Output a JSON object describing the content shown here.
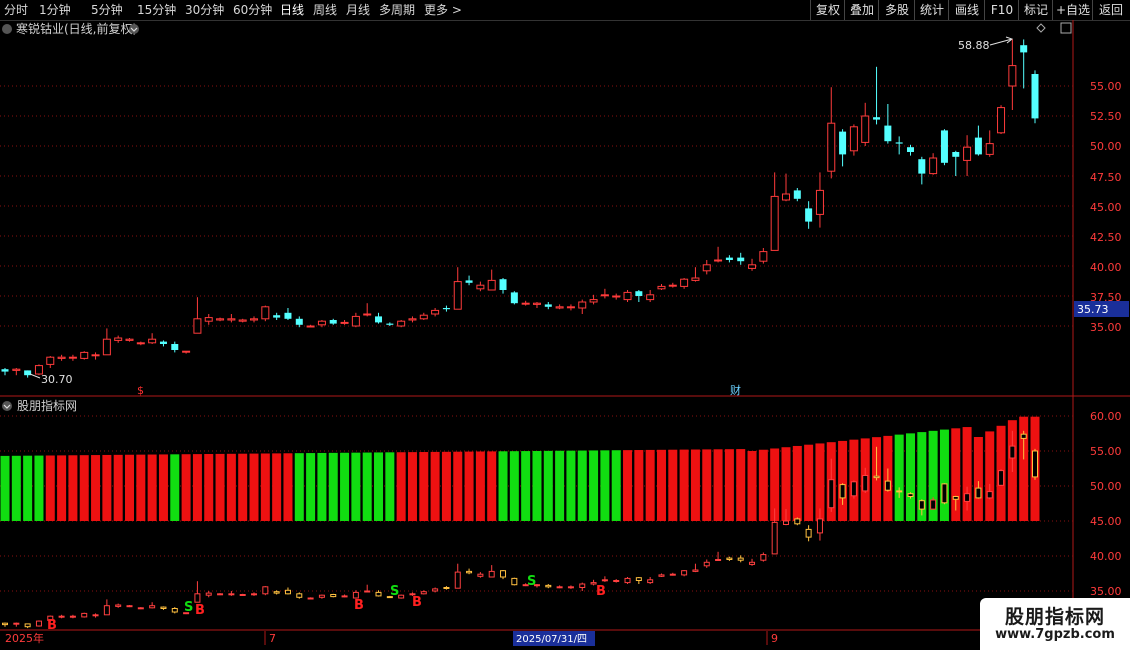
{
  "toolbar": {
    "periods": [
      "分时",
      "1分钟",
      "5分钟",
      "15分钟",
      "30分钟",
      "60分钟",
      "日线",
      "周线",
      "月线",
      "多周期",
      "更多 >"
    ],
    "active_period": "日线",
    "buttons": [
      "复权",
      "叠加",
      "多股",
      "统计",
      "画线",
      "F10",
      "标记",
      "+自选",
      "返回"
    ]
  },
  "main_panel": {
    "title": "寒锐钴业(日线,前复权)",
    "high_label": "58.88",
    "low_label": "30.70",
    "current_price": "35.73",
    "price_ticks": [
      "55.00",
      "52.50",
      "50.00",
      "47.50",
      "45.00",
      "42.50",
      "40.00",
      "37.50",
      "35.00"
    ],
    "markers": [
      "$",
      "财"
    ]
  },
  "indicator_panel": {
    "title": "股朋指标网",
    "ticks": [
      "60.00",
      "55.00",
      "50.00",
      "45.00",
      "40.00",
      "35.00"
    ],
    "signals": [
      "B",
      "S",
      "B",
      "B",
      "S",
      "B",
      "S",
      "B"
    ]
  },
  "time_axis": {
    "labels": [
      "2025年",
      "7",
      "2025/07/31/四",
      "9"
    ]
  },
  "watermark": {
    "title": "股朋指标网",
    "url": "www.7gpzb.com"
  },
  "colors": {
    "up": "#ff3b3b",
    "down": "#54ffff",
    "green_bar": "#11dd11",
    "red_bar": "#ee1111",
    "grid": "#8a1010"
  },
  "chart_data": {
    "type": "candlestick",
    "ylim_main": [
      30,
      60
    ],
    "ylim_indicator": [
      33,
      62
    ],
    "candles": [
      {
        "o": 31.4,
        "c": 31.2,
        "h": 31.5,
        "l": 30.9
      },
      {
        "o": 31.3,
        "c": 31.4,
        "h": 31.5,
        "l": 30.9
      },
      {
        "o": 31.3,
        "c": 30.9,
        "h": 31.3,
        "l": 30.7
      },
      {
        "o": 31.0,
        "c": 31.7,
        "h": 31.8,
        "l": 30.9
      },
      {
        "o": 31.8,
        "c": 32.4,
        "h": 32.5,
        "l": 31.5
      },
      {
        "o": 32.3,
        "c": 32.4,
        "h": 32.6,
        "l": 32.1
      },
      {
        "o": 32.4,
        "c": 32.4,
        "h": 32.6,
        "l": 32.1
      },
      {
        "o": 32.3,
        "c": 32.8,
        "h": 32.9,
        "l": 32.2
      },
      {
        "o": 32.6,
        "c": 32.6,
        "h": 32.8,
        "l": 32.2
      },
      {
        "o": 32.6,
        "c": 33.9,
        "h": 34.8,
        "l": 32.6
      },
      {
        "o": 33.8,
        "c": 34.0,
        "h": 34.2,
        "l": 33.6
      },
      {
        "o": 33.8,
        "c": 33.9,
        "h": 34.0,
        "l": 33.7
      },
      {
        "o": 33.6,
        "c": 33.6,
        "h": 33.7,
        "l": 33.4
      },
      {
        "o": 33.6,
        "c": 33.9,
        "h": 34.4,
        "l": 33.5
      },
      {
        "o": 33.7,
        "c": 33.5,
        "h": 33.8,
        "l": 33.3
      },
      {
        "o": 33.5,
        "c": 33.0,
        "h": 33.7,
        "l": 32.8
      },
      {
        "o": 32.9,
        "c": 32.9,
        "h": 32.9,
        "l": 32.7
      },
      {
        "o": 34.4,
        "c": 35.6,
        "h": 37.4,
        "l": 34.4
      },
      {
        "o": 35.4,
        "c": 35.7,
        "h": 36.0,
        "l": 35.1
      },
      {
        "o": 35.5,
        "c": 35.6,
        "h": 35.7,
        "l": 35.4
      },
      {
        "o": 35.5,
        "c": 35.6,
        "h": 36.0,
        "l": 35.3
      },
      {
        "o": 35.4,
        "c": 35.5,
        "h": 35.6,
        "l": 35.3
      },
      {
        "o": 35.5,
        "c": 35.6,
        "h": 35.8,
        "l": 35.3
      },
      {
        "o": 35.6,
        "c": 36.6,
        "h": 36.7,
        "l": 35.4
      },
      {
        "o": 35.9,
        "c": 35.7,
        "h": 36.1,
        "l": 35.5
      },
      {
        "o": 36.1,
        "c": 35.6,
        "h": 36.5,
        "l": 35.5
      },
      {
        "o": 35.6,
        "c": 35.1,
        "h": 35.8,
        "l": 34.9
      },
      {
        "o": 35.0,
        "c": 35.0,
        "h": 35.1,
        "l": 34.9
      },
      {
        "o": 35.1,
        "c": 35.4,
        "h": 35.5,
        "l": 34.9
      },
      {
        "o": 35.5,
        "c": 35.2,
        "h": 35.6,
        "l": 35.1
      },
      {
        "o": 35.3,
        "c": 35.3,
        "h": 35.5,
        "l": 35.1
      },
      {
        "o": 35.0,
        "c": 35.8,
        "h": 36.1,
        "l": 34.9
      },
      {
        "o": 36.0,
        "c": 36.0,
        "h": 36.9,
        "l": 35.8
      },
      {
        "o": 35.8,
        "c": 35.3,
        "h": 36.1,
        "l": 35.2
      },
      {
        "o": 35.2,
        "c": 35.1,
        "h": 35.3,
        "l": 35.0
      },
      {
        "o": 35.0,
        "c": 35.4,
        "h": 35.5,
        "l": 34.9
      },
      {
        "o": 35.5,
        "c": 35.6,
        "h": 35.8,
        "l": 35.3
      },
      {
        "o": 35.6,
        "c": 35.9,
        "h": 36.1,
        "l": 35.5
      },
      {
        "o": 36.0,
        "c": 36.3,
        "h": 36.5,
        "l": 35.8
      },
      {
        "o": 36.5,
        "c": 36.4,
        "h": 36.7,
        "l": 36.2
      },
      {
        "o": 36.4,
        "c": 38.7,
        "h": 39.9,
        "l": 36.4
      },
      {
        "o": 38.8,
        "c": 38.6,
        "h": 39.2,
        "l": 38.4
      },
      {
        "o": 38.1,
        "c": 38.4,
        "h": 38.7,
        "l": 37.9
      },
      {
        "o": 38.0,
        "c": 38.8,
        "h": 39.7,
        "l": 38.0
      },
      {
        "o": 38.9,
        "c": 38.0,
        "h": 39.0,
        "l": 37.7
      },
      {
        "o": 37.8,
        "c": 36.9,
        "h": 37.9,
        "l": 36.8
      },
      {
        "o": 36.9,
        "c": 36.9,
        "h": 37.1,
        "l": 36.7
      },
      {
        "o": 36.8,
        "c": 36.9,
        "h": 37.0,
        "l": 36.5
      },
      {
        "o": 36.8,
        "c": 36.6,
        "h": 37.0,
        "l": 36.4
      },
      {
        "o": 36.5,
        "c": 36.6,
        "h": 36.8,
        "l": 36.4
      },
      {
        "o": 36.6,
        "c": 36.6,
        "h": 36.8,
        "l": 36.3
      },
      {
        "o": 36.5,
        "c": 37.0,
        "h": 37.2,
        "l": 36.0
      },
      {
        "o": 37.0,
        "c": 37.2,
        "h": 37.6,
        "l": 36.8
      },
      {
        "o": 37.6,
        "c": 37.6,
        "h": 38.1,
        "l": 37.3
      },
      {
        "o": 37.5,
        "c": 37.5,
        "h": 37.7,
        "l": 37.2
      },
      {
        "o": 37.2,
        "c": 37.8,
        "h": 38.0,
        "l": 37.0
      },
      {
        "o": 37.9,
        "c": 37.5,
        "h": 38.0,
        "l": 37.0
      },
      {
        "o": 37.2,
        "c": 37.6,
        "h": 38.0,
        "l": 37.0
      },
      {
        "o": 38.1,
        "c": 38.3,
        "h": 38.5,
        "l": 38.0
      },
      {
        "o": 38.4,
        "c": 38.4,
        "h": 38.6,
        "l": 38.2
      },
      {
        "o": 38.3,
        "c": 38.9,
        "h": 39.0,
        "l": 38.1
      },
      {
        "o": 38.8,
        "c": 39.0,
        "h": 39.9,
        "l": 38.7
      },
      {
        "o": 39.6,
        "c": 40.1,
        "h": 40.5,
        "l": 39.3
      },
      {
        "o": 40.5,
        "c": 40.5,
        "h": 41.6,
        "l": 40.3
      },
      {
        "o": 40.7,
        "c": 40.5,
        "h": 40.9,
        "l": 40.3
      },
      {
        "o": 40.7,
        "c": 40.4,
        "h": 41.1,
        "l": 40.1
      },
      {
        "o": 39.8,
        "c": 40.1,
        "h": 40.6,
        "l": 39.6
      },
      {
        "o": 40.4,
        "c": 41.2,
        "h": 41.5,
        "l": 40.2
      },
      {
        "o": 41.3,
        "c": 45.8,
        "h": 47.8,
        "l": 41.3
      },
      {
        "o": 45.5,
        "c": 46.0,
        "h": 47.7,
        "l": 45.4
      },
      {
        "o": 46.3,
        "c": 45.6,
        "h": 46.5,
        "l": 45.4
      },
      {
        "o": 44.8,
        "c": 43.7,
        "h": 45.4,
        "l": 43.1
      },
      {
        "o": 44.3,
        "c": 46.3,
        "h": 47.8,
        "l": 43.2
      },
      {
        "o": 47.9,
        "c": 51.9,
        "h": 54.9,
        "l": 47.3
      },
      {
        "o": 51.2,
        "c": 49.3,
        "h": 51.4,
        "l": 48.3
      },
      {
        "o": 49.6,
        "c": 51.6,
        "h": 51.8,
        "l": 49.2
      },
      {
        "o": 50.3,
        "c": 52.5,
        "h": 53.6,
        "l": 50.0
      },
      {
        "o": 52.4,
        "c": 52.2,
        "h": 56.6,
        "l": 51.8
      },
      {
        "o": 51.7,
        "c": 50.4,
        "h": 53.5,
        "l": 50.2
      },
      {
        "o": 50.3,
        "c": 50.2,
        "h": 50.8,
        "l": 49.3
      },
      {
        "o": 49.9,
        "c": 49.5,
        "h": 50.1,
        "l": 49.2
      },
      {
        "o": 48.9,
        "c": 47.7,
        "h": 49.1,
        "l": 46.8
      },
      {
        "o": 47.7,
        "c": 49.0,
        "h": 49.4,
        "l": 47.6
      },
      {
        "o": 51.3,
        "c": 48.6,
        "h": 51.4,
        "l": 48.4
      },
      {
        "o": 49.5,
        "c": 49.1,
        "h": 49.6,
        "l": 47.5
      },
      {
        "o": 48.8,
        "c": 49.9,
        "h": 50.9,
        "l": 47.5
      },
      {
        "o": 50.7,
        "c": 49.3,
        "h": 51.7,
        "l": 49.2
      },
      {
        "o": 49.3,
        "c": 50.2,
        "h": 51.3,
        "l": 49.1
      },
      {
        "o": 51.1,
        "c": 53.2,
        "h": 53.4,
        "l": 51.0
      },
      {
        "o": 55.0,
        "c": 56.7,
        "h": 58.88,
        "l": 53.0
      },
      {
        "o": 58.4,
        "c": 57.8,
        "h": 58.88,
        "l": 54.8
      },
      {
        "o": 56.0,
        "c": 52.3,
        "h": 56.3,
        "l": 51.9
      }
    ]
  }
}
